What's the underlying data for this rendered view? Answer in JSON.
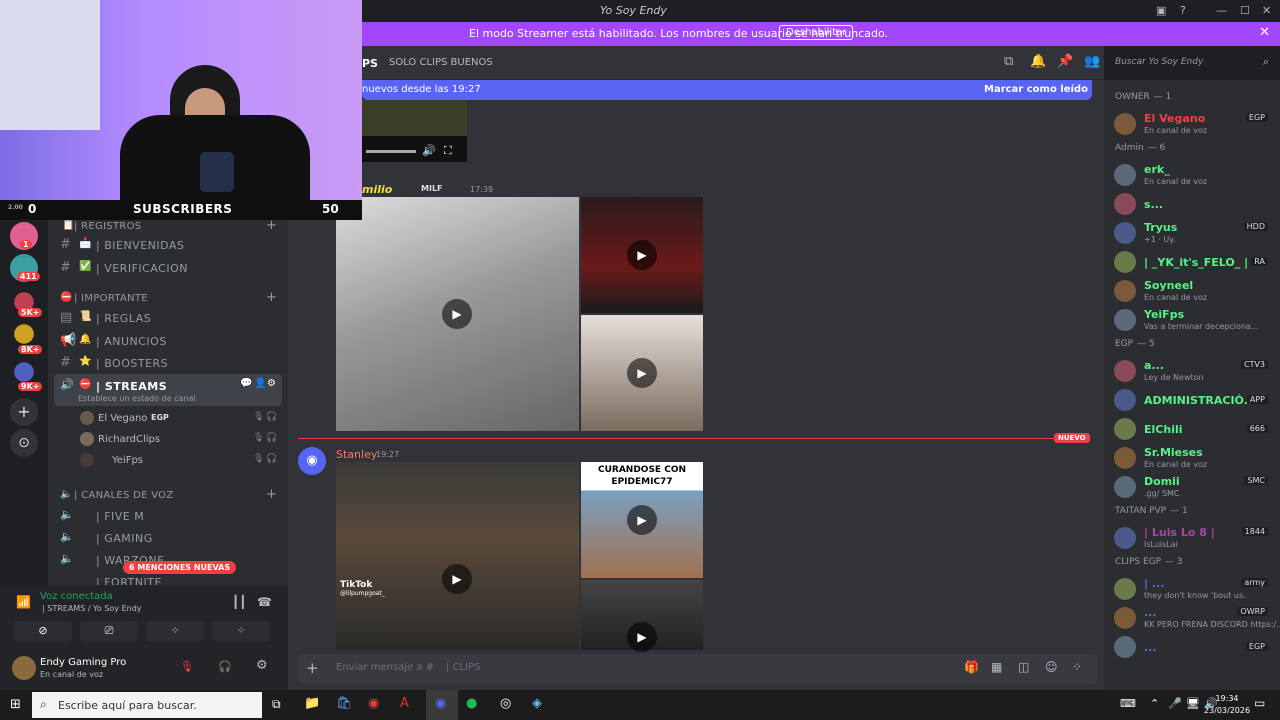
{
  "window": {
    "title": "Yo Soy Endy",
    "controls": [
      "—",
      "☐",
      "✕"
    ]
  },
  "banner": {
    "text": "El modo Streamer está habilitado. Los nombres de usuario se han truncado.",
    "button": "Deshabilitar"
  },
  "webcam": {
    "subscribers_label": "SUBSCRIBERS",
    "left_count": "0",
    "right_count": "50",
    "left_small": "2.00"
  },
  "rail": {
    "badges": [
      "1",
      "411",
      "5K+",
      "8K+",
      "9K+"
    ]
  },
  "sidebar": {
    "categories": [
      {
        "label": "| REGISTROS",
        "channels": [
          {
            "name": "| BIENVENIDAS",
            "emoji": "📩"
          },
          {
            "name": "| VERIFICACION",
            "emoji": "✅"
          }
        ]
      },
      {
        "label": "| IMPORTANTE",
        "channels": [
          {
            "name": "| REGLAS",
            "emoji": "📜"
          },
          {
            "name": "| ANUNCIOS",
            "emoji": "🔔"
          },
          {
            "name": "| BOOSTERS",
            "emoji": "⭐"
          }
        ]
      }
    ],
    "streams": {
      "name": "| STREAMS",
      "status": "Establece un estado de canal",
      "users": [
        {
          "name": "El Vegano",
          "tag": "EGP"
        },
        {
          "name": "RichardClips",
          "tag": ""
        },
        {
          "name": "YeiFps",
          "tag": ""
        }
      ]
    },
    "voice_category": "| CANALES DE VOZ",
    "voice_channels": [
      "| FIVE M",
      "| GAMING",
      "| WARZONE",
      "| FORTNITE"
    ],
    "mentions_pill": "6 MENCIONES NUEVAS"
  },
  "voice_panel": {
    "status": "Voz conectada",
    "location": "| STREAMS / Yo Soy Endy",
    "user_name": "Endy Gaming Pro",
    "user_status": "En canal de voz"
  },
  "chat": {
    "channel_name": "SOLO CLIPS BUENOS",
    "channel_prefix": "PS",
    "new_since": "nuevos desde las 19:27",
    "mark_read": "Marcar como leído",
    "messages": [
      {
        "author": "milio",
        "author_tag": "MILF",
        "time": "17:39",
        "color": "#f0e040"
      },
      {
        "author": "Stanley",
        "time": "19:27",
        "color": "#f47b67"
      }
    ],
    "new_label": "NUEVO",
    "tiktok_label": "TikTok",
    "tiktok_user": "@lilpumpgoat_",
    "clip_caption": "CURANDOSE CON EPIDEMIC77",
    "input_placeholder": "Enviar mensaje a #",
    "input_channel": "| CLIPS"
  },
  "search": {
    "placeholder": "Buscar Yo Soy Endy"
  },
  "members": {
    "groups": [
      {
        "header": "OWNER",
        "count": "— 1",
        "members": [
          {
            "name": "El Vegano",
            "color": "#f23f43",
            "tag": "EGP",
            "sub": "En canal de voz"
          }
        ]
      },
      {
        "header": "Admin",
        "count": "— 6",
        "members": [
          {
            "name": "erk_",
            "color": "#57f287",
            "tag": "",
            "sub": "En canal de voz"
          },
          {
            "name": "s...",
            "color": "#57f287",
            "tag": "",
            "sub": ""
          },
          {
            "name": "Tryus",
            "color": "#57f287",
            "tag": "HDD",
            "sub": "+1 · Uy."
          },
          {
            "name": "| _YK_it's_FELO_ |",
            "color": "#57f287",
            "tag": "RA",
            "sub": ""
          },
          {
            "name": "Soyneel",
            "color": "#57f287",
            "tag": "",
            "sub": "En canal de voz"
          },
          {
            "name": "YeiFps",
            "color": "#57f287",
            "tag": "",
            "sub": "Vas a terminar decepciona..."
          }
        ]
      },
      {
        "header": "EGP",
        "count": "— 5",
        "members": [
          {
            "name": "a...",
            "color": "#57f287",
            "tag": "CTV3",
            "sub": "Ley de Newton"
          },
          {
            "name": "ADMINISTRACIÓ...",
            "color": "#57f287",
            "tag": "APP",
            "sub": ""
          },
          {
            "name": "ElChili",
            "color": "#57f287",
            "tag": "666",
            "sub": ""
          },
          {
            "name": "Sr.Mieses",
            "color": "#57f287",
            "tag": "",
            "sub": "En canal de voz"
          },
          {
            "name": "Domii",
            "color": "#57f287",
            "tag": "SMC",
            "sub": ".gg/ SMC"
          }
        ]
      },
      {
        "header": "TAITAN PVP",
        "count": "— 1",
        "members": [
          {
            "name": "| Luis Lo 8 |",
            "color": "#a349a4",
            "tag": "1844",
            "sub": "IsLuisLai"
          }
        ]
      },
      {
        "header": "CLIPS EGP",
        "count": "— 3",
        "members": [
          {
            "name": "| ...",
            "color": "#5865f2",
            "tag": "army",
            "sub": "they don't know 'bout us."
          },
          {
            "name": "...",
            "color": "#5865f2",
            "tag": "OWRP",
            "sub": "KK PERO FRENA DISCORD https:/..."
          },
          {
            "name": "...",
            "color": "#5865f2",
            "tag": "EGP",
            "sub": ""
          }
        ]
      }
    ]
  },
  "taskbar": {
    "search": "Escribe aquí para buscar.",
    "time": "19:34",
    "date": "23/03/2026"
  },
  "colors": {
    "accent": "#5865f2",
    "streamer_banner": "#a347ff",
    "voice_green": "#23a55a",
    "new_red": "#f23f43"
  }
}
